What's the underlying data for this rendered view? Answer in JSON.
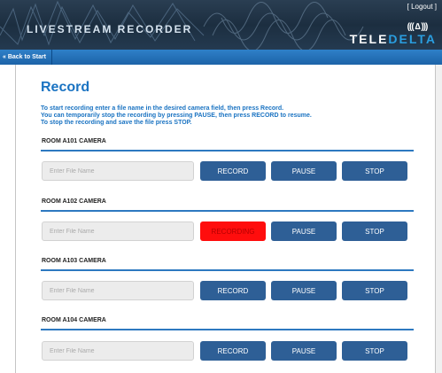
{
  "header": {
    "app_title": "LiveStream Recorder",
    "logout_label": "[ Logout ]",
    "brand_waves": "((( ∆ )))",
    "brand_part1": "TELE",
    "brand_part2": "DELTA"
  },
  "nav": {
    "back_label": "« Back to Start"
  },
  "page": {
    "title": "Record",
    "instructions": [
      "To start recording enter a file name in the desired camera field, then press Record.",
      "You can temporarily stop the recording by pressing PAUSE, then press RECORD to resume.",
      "To stop the recording and save the file press STOP."
    ]
  },
  "cameras": [
    {
      "name": "ROOM A101 CAMERA",
      "input_placeholder": "Enter File Name",
      "record_label": "RECORD",
      "pause_label": "PAUSE",
      "stop_label": "STOP"
    },
    {
      "name": "ROOM A102 CAMERA",
      "input_placeholder": "Enter File Name",
      "record_label": "RECORDING",
      "pause_label": "PAUSE",
      "stop_label": "STOP"
    },
    {
      "name": "ROOM A103 CAMERA",
      "input_placeholder": "Enter File Name",
      "record_label": "RECORD",
      "pause_label": "PAUSE",
      "stop_label": "STOP"
    },
    {
      "name": "ROOM A104 CAMERA",
      "input_placeholder": "Enter File Name",
      "record_label": "RECORD",
      "pause_label": "PAUSE",
      "stop_label": "STOP"
    }
  ],
  "colors": {
    "accent_blue": "#1a73c2",
    "button_blue": "#2e5f96",
    "recording_red": "#ff0d0d"
  }
}
